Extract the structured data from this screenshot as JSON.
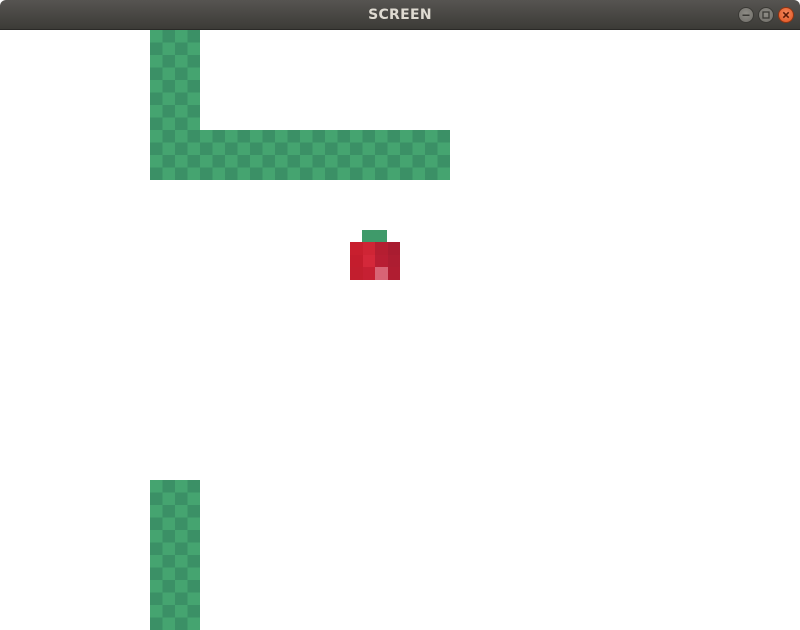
{
  "window": {
    "title": "SCREEN"
  },
  "controls": {
    "minimize_icon": "minimize-icon",
    "maximize_icon": "maximize-icon",
    "close_icon": "close-icon"
  },
  "game": {
    "background": "#ffffff",
    "snake_color": "#45a470",
    "snake_shade": "#3b9066",
    "apple_color": "#c21f30",
    "apple_stem_color": "#3f9a6a"
  }
}
